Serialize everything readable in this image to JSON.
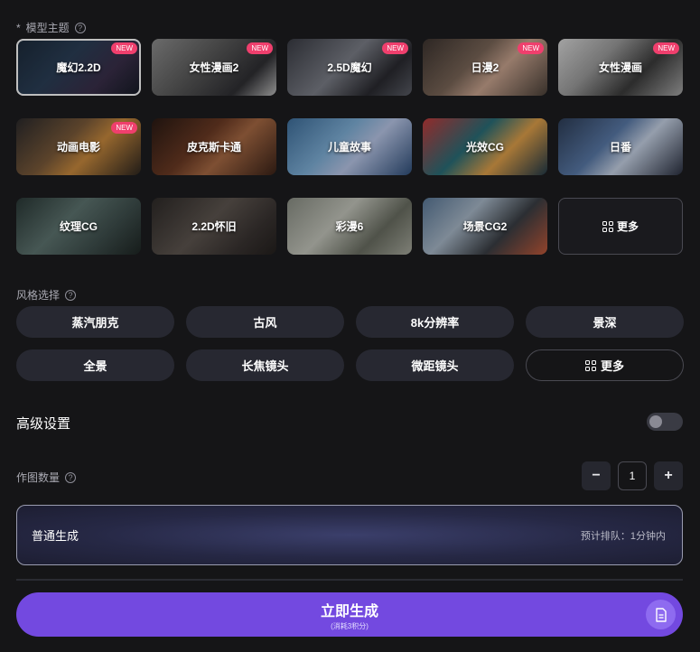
{
  "model_theme": {
    "required_mark": "*",
    "label": "模型主题",
    "help_glyph": "?",
    "items": [
      {
        "title": "魔幻2.2D",
        "badge": "NEW",
        "selected": true,
        "bg": "linear-gradient(135deg,#1c2a3a 0%,#2b3f57 40%,#3a2f4a 70%,#141a24 100%)"
      },
      {
        "title": "女性漫画2",
        "badge": "NEW",
        "bg": "linear-gradient(135deg,#8f8f8f 0%,#5c5c5c 40%,#2f2f33 75%,#bdbdbd 100%)"
      },
      {
        "title": "2.5D魔幻",
        "badge": "NEW",
        "bg": "linear-gradient(135deg,#3a3c44 0%,#7c7f88 45%,#2a2a30 75%,#5a5d66 100%)"
      },
      {
        "title": "日漫2",
        "badge": "NEW",
        "bg": "linear-gradient(135deg,#3d3430 0%,#7a6658 40%,#c9a48f 60%,#4a4038 100%)"
      },
      {
        "title": "女性漫画",
        "badge": "NEW",
        "bg": "linear-gradient(135deg,#d9d9d9 0%,#9c9c9c 35%,#3b3b3b 65%,#a8a8a8 100%)"
      },
      {
        "title": "动画电影",
        "badge": "NEW",
        "bg": "linear-gradient(135deg,#2b2a2c 0%,#7a5a3a 40%,#c98a3e 60%,#2d2620 100%)"
      },
      {
        "title": "皮克斯卡通",
        "bg": "linear-gradient(135deg,#2a1a14 0%,#6b3a24 40%,#a86a44 60%,#3a2218 100%)"
      },
      {
        "title": "儿童故事",
        "bg": "linear-gradient(135deg,#3f6f9c 0%,#7fb0d8 40%,#b9c7e8 60%,#2f4f7a 100%)"
      },
      {
        "title": "光效CG",
        "bg": "linear-gradient(135deg,#c23a3a 0%,#2a6e78 40%,#e0a04a 65%,#203848 100%)"
      },
      {
        "title": "日番",
        "bg": "linear-gradient(135deg,#2e3e58 0%,#5a7aa8 40%,#c7d3e6 60%,#2a3040 100%)"
      },
      {
        "title": "纹理CG",
        "bg": "linear-gradient(135deg,#2a3836 0%,#5e7470 40%,#3e4e4c 70%,#1e2624 100%)"
      },
      {
        "title": "2.2D怀旧",
        "bg": "linear-gradient(135deg,#2e2a28 0%,#5e5650 45%,#3a3432 75%,#24201e 100%)"
      },
      {
        "title": "彩漫6",
        "bg": "linear-gradient(135deg,#8a8e84 0%,#c4c6bc 40%,#6a6e62 70%,#a8aa9e 100%)"
      },
      {
        "title": "场景CG2",
        "bg": "linear-gradient(135deg,#5a7898 0%,#a8b8c8 35%,#3a3e44 65%,#c45a3a 100%)"
      }
    ],
    "more_label": "更多"
  },
  "style_select": {
    "label": "风格选择",
    "items": [
      "蒸汽朋克",
      "古风",
      "8k分辨率",
      "景深",
      "全景",
      "长焦镜头",
      "微距镜头"
    ],
    "more_label": "更多"
  },
  "advanced": {
    "label": "高级设置",
    "enabled": false
  },
  "count": {
    "label": "作图数量",
    "minus": "−",
    "plus": "+",
    "value": "1"
  },
  "generation": {
    "mode_label": "普通生成",
    "queue_text": "预计排队：1分钟内"
  },
  "submit": {
    "label": "立即生成",
    "cost": "(消耗3积分)"
  },
  "colors": {
    "accent": "#7349e0",
    "badge": "#ef3f6d",
    "background": "#151517"
  }
}
